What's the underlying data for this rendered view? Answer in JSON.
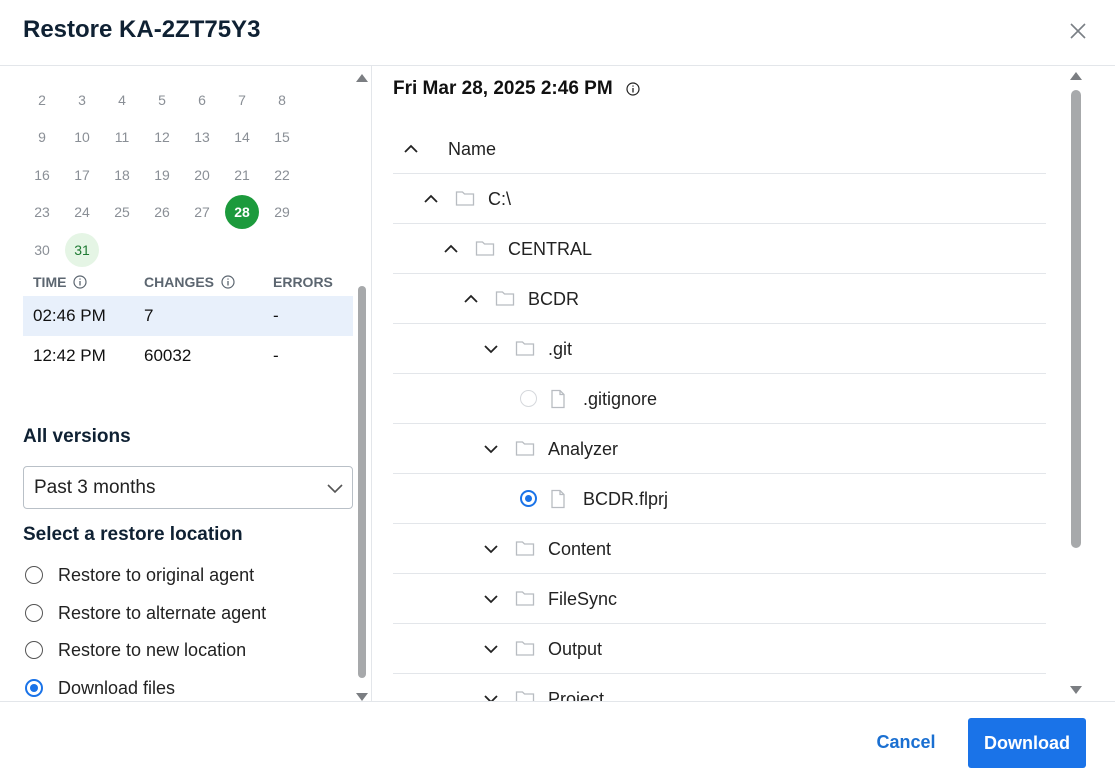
{
  "dialog": {
    "title": "Restore KA-2ZT75Y3"
  },
  "calendar": {
    "rows": [
      [
        "2",
        "3",
        "4",
        "5",
        "6",
        "7",
        "8"
      ],
      [
        "9",
        "10",
        "11",
        "12",
        "13",
        "14",
        "15"
      ],
      [
        "16",
        "17",
        "18",
        "19",
        "20",
        "21",
        "22"
      ],
      [
        "23",
        "24",
        "25",
        "26",
        "27",
        "28",
        "29"
      ],
      [
        "30",
        "31"
      ]
    ],
    "selected_day": "28",
    "today_day": "31",
    "selected_color": "#1c9a3c"
  },
  "versions": {
    "headers": {
      "time": "TIME",
      "changes": "CHANGES",
      "errors": "ERRORS"
    },
    "rows": [
      {
        "time": "02:46 PM",
        "changes": "7",
        "errors": "-"
      },
      {
        "time": "12:42 PM",
        "changes": "60032",
        "errors": "-"
      }
    ]
  },
  "all_versions": {
    "label": "All versions",
    "selected": "Past 3 months"
  },
  "restore_location": {
    "label": "Select a restore location",
    "options": [
      {
        "label": "Restore to original agent",
        "checked": false
      },
      {
        "label": "Restore to alternate agent",
        "checked": false
      },
      {
        "label": "Restore to new location",
        "checked": false
      },
      {
        "label": "Download files",
        "checked": true
      }
    ]
  },
  "snapshot": {
    "title": "Fri Mar 28, 2025 2:46 PM"
  },
  "tree": {
    "header": "Name",
    "rows": [
      {
        "name": "C:\\",
        "type": "folder",
        "expanded": true
      },
      {
        "name": "CENTRAL",
        "type": "folder",
        "expanded": true
      },
      {
        "name": "BCDR",
        "type": "folder",
        "expanded": true
      },
      {
        "name": ".git",
        "type": "folder",
        "expanded": false
      },
      {
        "name": ".gitignore",
        "type": "file",
        "selected": false
      },
      {
        "name": "Analyzer",
        "type": "folder",
        "expanded": false
      },
      {
        "name": "BCDR.flprj",
        "type": "file",
        "selected": true
      },
      {
        "name": "Content",
        "type": "folder",
        "expanded": false
      },
      {
        "name": "FileSync",
        "type": "folder",
        "expanded": false
      },
      {
        "name": "Output",
        "type": "folder",
        "expanded": false
      },
      {
        "name": "Project",
        "type": "folder",
        "expanded": false
      }
    ]
  },
  "footer": {
    "cancel_label": "Cancel",
    "download_label": "Download"
  },
  "colors": {
    "accent": "#1a73e8",
    "selected_row": "#e8f0fb"
  },
  "icons": [
    "close-icon",
    "info-icon",
    "chevron-up-icon",
    "chevron-down-icon",
    "folder-icon",
    "file-icon"
  ]
}
